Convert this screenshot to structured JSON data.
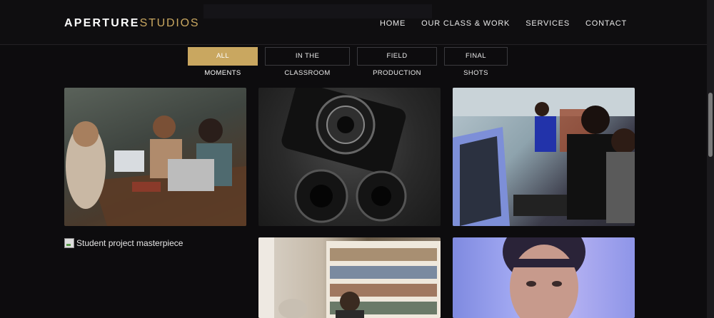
{
  "header": {
    "brand_bold": "APERTURE",
    "brand_light": "STUDIOS",
    "nav": [
      {
        "label": "HOME"
      },
      {
        "label": "OUR CLASS & WORK"
      },
      {
        "label": "SERVICES"
      },
      {
        "label": "CONTACT"
      }
    ]
  },
  "filters": [
    {
      "label": "ALL MOMENTS",
      "active": true
    },
    {
      "label": "IN THE CLASSROOM",
      "active": false
    },
    {
      "label": "FIELD PRODUCTION",
      "active": false
    },
    {
      "label": "FINAL SHOTS",
      "active": false
    }
  ],
  "gallery": {
    "broken_alt": "Student project masterpiece"
  },
  "colors": {
    "accent": "#c9a760",
    "background": "#0d0c0e"
  }
}
